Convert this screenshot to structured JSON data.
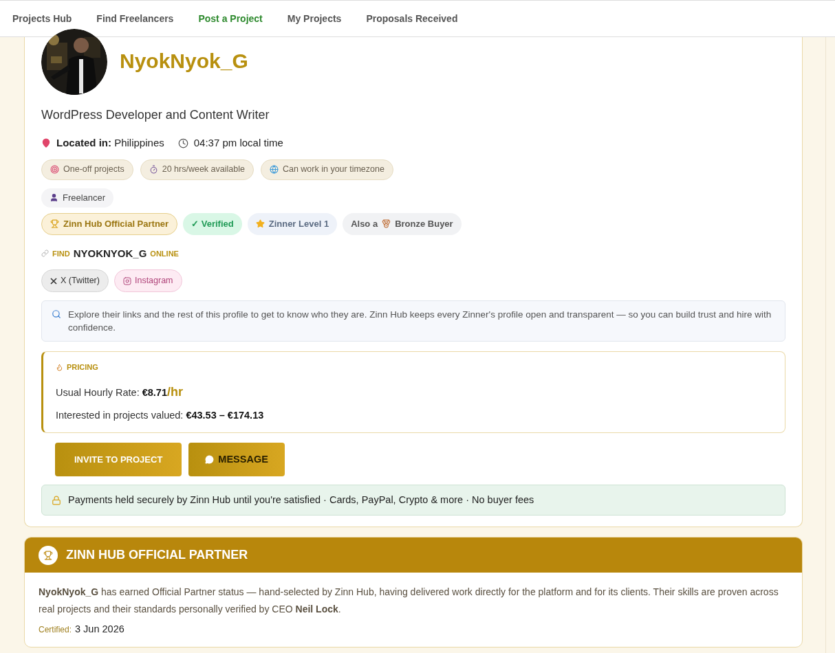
{
  "nav": {
    "items": [
      {
        "label": "Projects Hub",
        "selected": false
      },
      {
        "label": "Find Freelancers",
        "selected": false
      },
      {
        "label": "Post a Project",
        "selected": true
      },
      {
        "label": "My Projects",
        "selected": false
      },
      {
        "label": "Proposals Received",
        "selected": false
      }
    ]
  },
  "profile": {
    "name": "NyokNyok_G",
    "headline": "WordPress Developer and Content Writer",
    "location": "**Located in:** Philippines",
    "local_time": "04:37 pm local time",
    "availability": [
      {
        "kind": "target",
        "label": "One-off projects"
      },
      {
        "kind": "stopwatch",
        "label": "20 hrs/week available"
      },
      {
        "kind": "globe",
        "label": "Can work in your timezone"
      }
    ],
    "role": "Freelancer",
    "badges": [
      {
        "kind": "partner",
        "label": "Zinn Hub Official Partner"
      },
      {
        "kind": "verified",
        "label": "✓ Verified"
      },
      {
        "kind": "level",
        "label": "Zinner Level 1"
      },
      {
        "kind": "buyer",
        "prefix": "Also a",
        "label": "Bronze Buyer"
      }
    ],
    "find_online": {
      "prefix": "FIND",
      "name": "NYOKNYOK_G",
      "suffix": "ONLINE"
    },
    "links": [
      {
        "kind": "x",
        "label": "X (Twitter)"
      },
      {
        "kind": "instagram",
        "label": "Instagram"
      }
    ],
    "note": "Explore their links and the rest of this profile to get to know who they are. Zinn Hub keeps every Zinner's profile open and transparent — so you can build trust and hire with confidence.",
    "pricing": {
      "title": "PRICING",
      "rate_label": "Usual Hourly Rate:",
      "rate": "€8.71",
      "rate_unit": "/hr",
      "range_label": "Interested in projects valued:",
      "range": "€43.53 – €174.13"
    },
    "buttons": [
      {
        "kind": "invite",
        "label": "INVITE TO PROJECT"
      },
      {
        "kind": "message",
        "label": "MESSAGE"
      }
    ],
    "payment_note": "Payments held securely by Zinn Hub until you're satisfied · Cards, PayPal, Crypto & more · No buyer fees"
  },
  "partner": {
    "title": "ZINN HUB OFFICIAL PARTNER",
    "text": "**NyokNyok_G** has earned Official Partner status — hand-selected by Zinn Hub, having delivered work directly for the platform and for its clients. Their skills are proven across real projects and their standards personally verified by CEO **Neil Lock**.",
    "certified_label": "Certified:",
    "certified_date": "3 Jun 2026"
  }
}
